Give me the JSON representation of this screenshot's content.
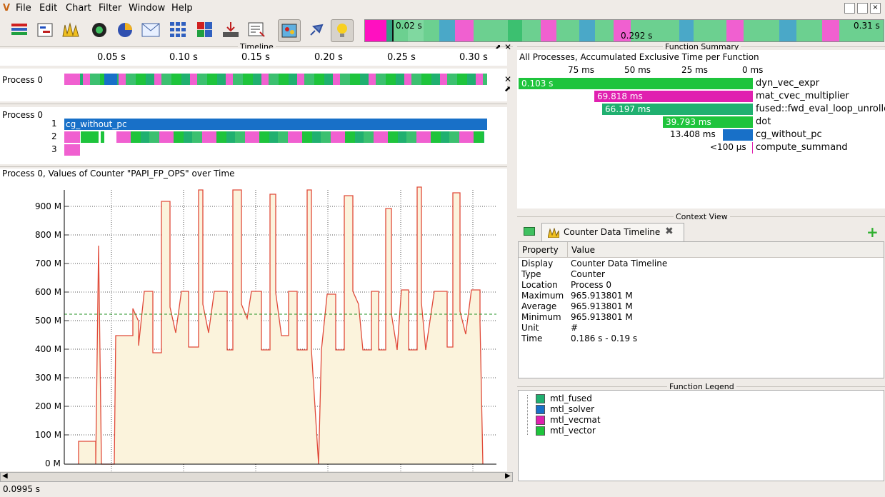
{
  "menu": [
    "File",
    "Edit",
    "Chart",
    "Filter",
    "Window",
    "Help"
  ],
  "toolbar_icons": [
    "trace-overview-icon",
    "timeline-icon",
    "counter-chart-icon",
    "summary-icon",
    "pie-chart-icon",
    "message-icon",
    "grid-icon",
    "color-grid-icon",
    "export-icon",
    "filter-icon",
    "color-legend-icon",
    "pin-icon",
    "bulb-icon"
  ],
  "overview": {
    "left_time": "0.02 s",
    "center_time": "0.292 s",
    "right_time": "0.31 s"
  },
  "timeline": {
    "title": "Timeline",
    "ticks": [
      "0.05 s",
      "0.10 s",
      "0.15 s",
      "0.20 s",
      "0.25 s",
      "0.30 s"
    ],
    "process0_label": "Process 0",
    "process0b_label": "Process 0",
    "rows": [
      "1",
      "2",
      "3"
    ],
    "row1_label": "cg_without_pc"
  },
  "counter": {
    "title": "Process 0, Values of Counter \"PAPI_FP_OPS\" over Time",
    "yticks": [
      "900 M",
      "800 M",
      "700 M",
      "600 M",
      "500 M",
      "400 M",
      "300 M",
      "200 M",
      "100 M",
      "0 M"
    ]
  },
  "function_summary": {
    "title": "Function Summary",
    "subtitle": "All Processes, Accumulated Exclusive Time per Function",
    "ticks": [
      "75 ms",
      "50 ms",
      "25 ms",
      "0 ms"
    ],
    "functions": [
      {
        "name": "dyn_vec_expr",
        "value": "0.103 s",
        "color": "#1ec43c"
      },
      {
        "name": "mat_cvec_multiplier",
        "value": "69.818 ms",
        "color": "#e020b0"
      },
      {
        "name": "fused::fwd_eval_loop_unrolled",
        "value": "66.197 ms",
        "color": "#20b070"
      },
      {
        "name": "dot",
        "value": "39.793 ms",
        "color": "#1ec43c"
      },
      {
        "name": "cg_without_pc",
        "value": "13.408 ms",
        "color": "#1870c8"
      },
      {
        "name": "compute_summand",
        "value": "<100 µs",
        "color": "#e020b0"
      }
    ]
  },
  "context_view": {
    "title": "Context View",
    "tab": "Counter Data Timeline",
    "header": {
      "property": "Property",
      "value": "Value"
    },
    "rows": [
      {
        "k": "Display",
        "v": "Counter Data Timeline"
      },
      {
        "k": "Type",
        "v": "Counter"
      },
      {
        "k": "Location",
        "v": "Process 0"
      },
      {
        "k": "Maximum",
        "v": "965.913801 M"
      },
      {
        "k": "Average",
        "v": "965.913801 M"
      },
      {
        "k": "Minimum",
        "v": "965.913801 M"
      },
      {
        "k": "Unit",
        "v": "#"
      },
      {
        "k": "Time",
        "v": "0.186 s - 0.19 s"
      }
    ]
  },
  "legend": {
    "title": "Function Legend",
    "items": [
      {
        "name": "mtl_fused",
        "color": "#20b070"
      },
      {
        "name": "mtl_solver",
        "color": "#1870c8"
      },
      {
        "name": "mtl_vecmat",
        "color": "#e020b0"
      },
      {
        "name": "mtl_vector",
        "color": "#1ec43c"
      }
    ]
  },
  "status": "0.0995 s"
}
